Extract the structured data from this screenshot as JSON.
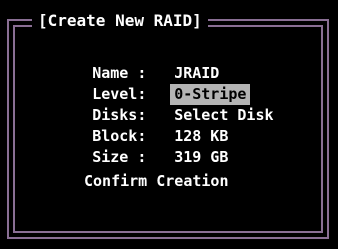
{
  "dialog": {
    "title": "[Create New RAID]",
    "fields": [
      {
        "label": "Name : ",
        "value": "JRAID"
      },
      {
        "label": "Level:",
        "value": "0-Stripe"
      },
      {
        "label": "Disks:",
        "value": "Select Disk"
      },
      {
        "label": "Block:",
        "value": "128 KB"
      },
      {
        "label": "Size : ",
        "value": "319 GB"
      }
    ],
    "confirm_label": "Confirm Creation"
  },
  "colors": {
    "background": "#000000",
    "text": "#ffffff",
    "frame": "#8a6f94",
    "selection_background": "#b4b4b4",
    "selection_text": "#000000"
  }
}
